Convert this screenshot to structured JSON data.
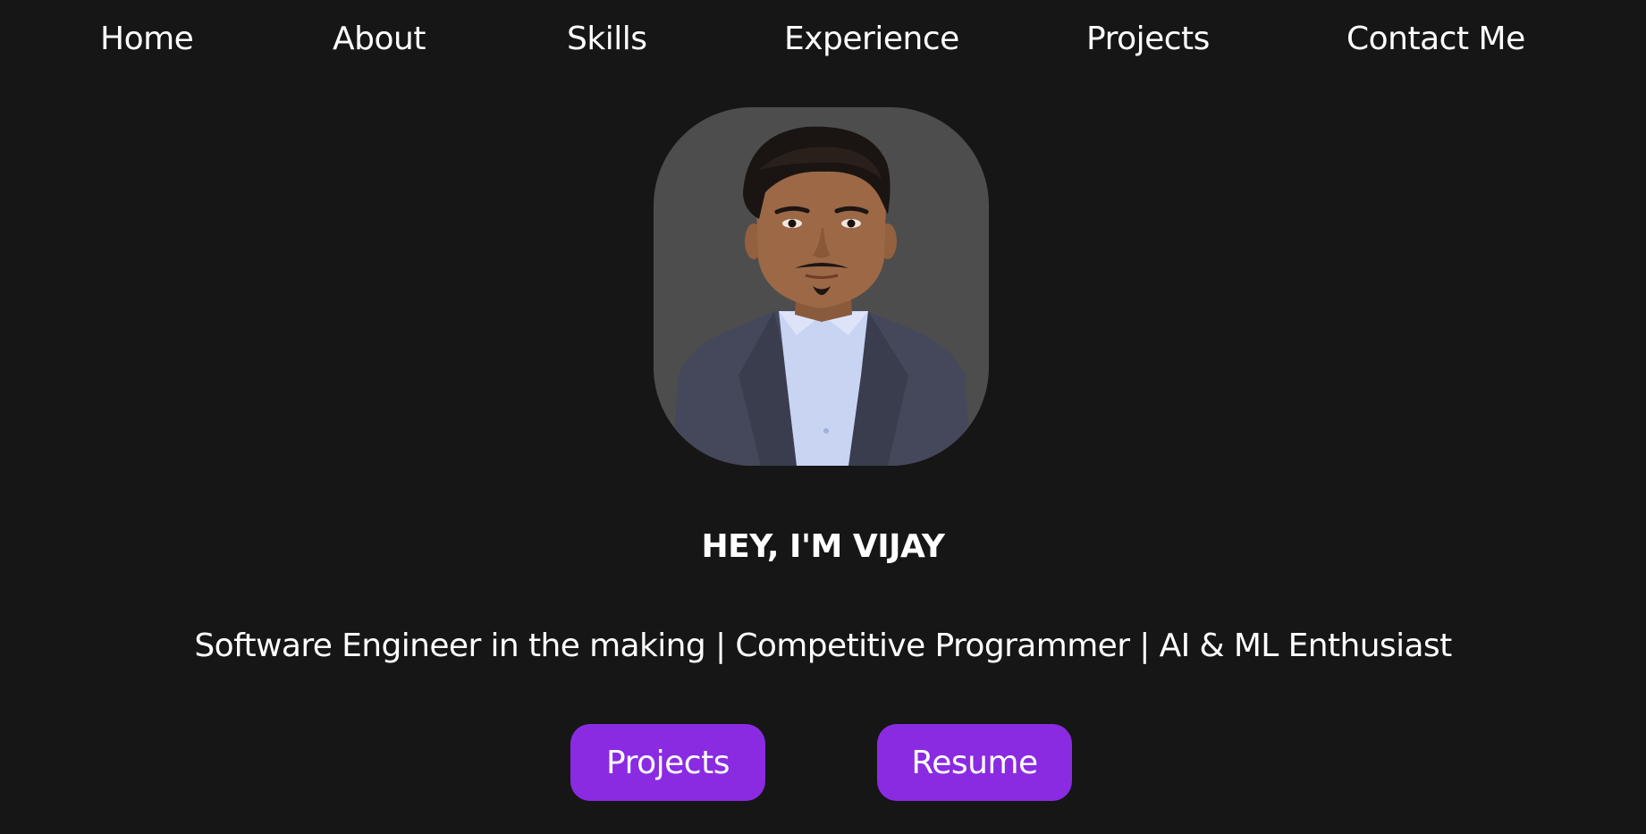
{
  "nav": {
    "items": [
      {
        "label": "Home"
      },
      {
        "label": "About"
      },
      {
        "label": "Skills"
      },
      {
        "label": "Experience"
      },
      {
        "label": "Projects"
      },
      {
        "label": "Contact Me"
      }
    ]
  },
  "hero": {
    "title": "HEY, I'M VIJAY",
    "subtitle": "Software Engineer in the making | Competitive Programmer | AI & ML Enthusiast",
    "buttons": {
      "projects": "Projects",
      "resume": "Resume"
    }
  },
  "colors": {
    "background": "#161616",
    "accent": "#8a2be2",
    "avatar_bg": "#4d4d4d",
    "text": "#ffffff"
  }
}
